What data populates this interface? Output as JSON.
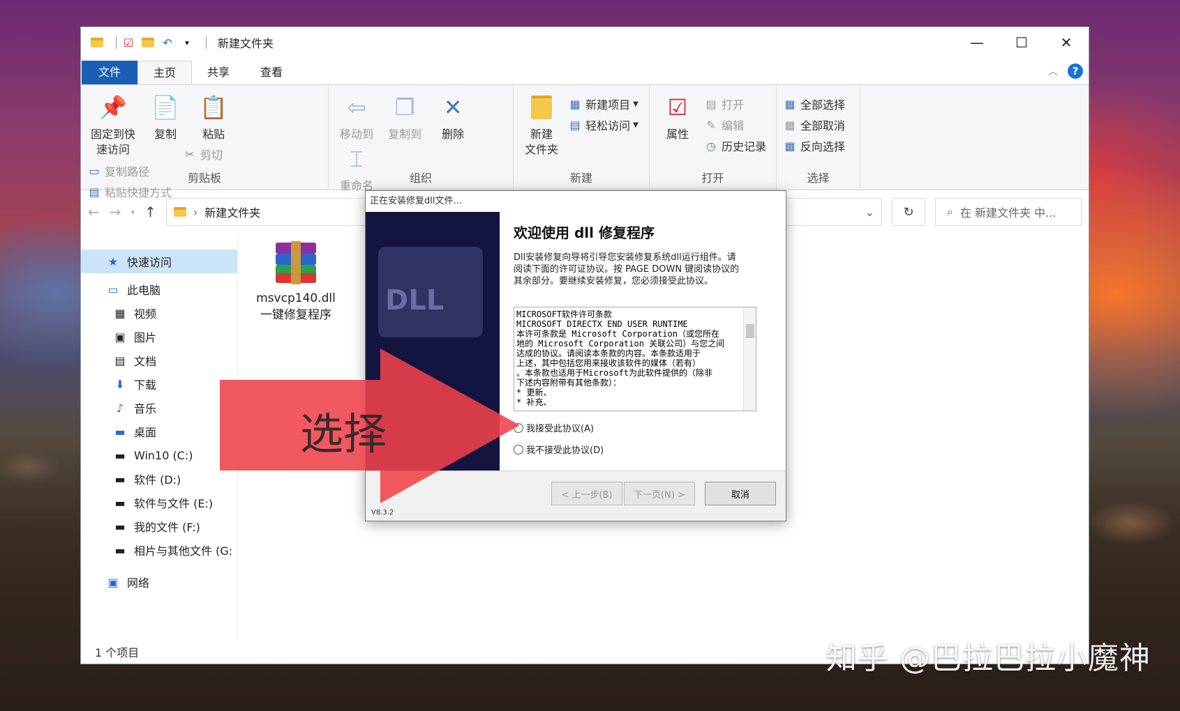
{
  "window": {
    "title": "新建文件夹",
    "controls": {
      "minimize": "—",
      "maximize": "☐",
      "close": "✕"
    }
  },
  "tabs": {
    "file": "文件",
    "home": "主页",
    "share": "共享",
    "view": "查看"
  },
  "ribbon": {
    "clipboard": {
      "label": "剪贴板",
      "pin": "固定到快\n速访问",
      "copy": "复制",
      "paste": "粘贴",
      "copy_path": "复制路径",
      "paste_shortcut": "粘贴快捷方式",
      "cut": "剪切"
    },
    "organize": {
      "label": "组织",
      "move_to": "移动到",
      "copy_to": "复制到",
      "delete": "删除",
      "rename": "重命名"
    },
    "new": {
      "label": "新建",
      "new_folder": "新建\n文件夹",
      "new_item": "新建项目",
      "easy_access": "轻松访问"
    },
    "open": {
      "label": "打开",
      "properties": "属性",
      "open": "打开",
      "edit": "编辑",
      "history": "历史记录"
    },
    "select": {
      "label": "选择",
      "select_all": "全部选择",
      "select_none": "全部取消",
      "invert": "反向选择"
    }
  },
  "address": {
    "path": "新建文件夹",
    "search_placeholder": "在 新建文件夹 中..."
  },
  "nav": {
    "quick_access": "快速访问",
    "this_pc": "此电脑",
    "videos": "视频",
    "pictures": "图片",
    "documents": "文档",
    "downloads": "下载",
    "music": "音乐",
    "desktop": "桌面",
    "drive_c": "Win10 (C:)",
    "drive_d": "软件 (D:)",
    "drive_e": "软件与文件 (E:)",
    "drive_f": "我的文件 (F:)",
    "drive_g": "相片与其他文件 (G:",
    "network": "网络"
  },
  "files": [
    {
      "name_line1": "msvcp140.dll",
      "name_line2": "一键修复程序"
    }
  ],
  "status": {
    "count": "1 个项目"
  },
  "dialog": {
    "title": "正在安装修复dll文件...",
    "side_text": "DLL",
    "heading": "欢迎使用 dll 修复程序",
    "description": "Dll安装修复向导将引导您安装修复系统dll运行组件。请阅读下面的许可证协议。按 PAGE DOWN 键阅读协议的其余部分。要继续安装修复，您必须接受此协议。",
    "license_lines": [
      "MICROSOFT软件许可条款",
      "MICROSOFT DIRECTX END USER RUNTIME",
      "本许可条款是 Microsoft Corporation（或您所在",
      "地的 Microsoft Corporation 关联公司）与您之间",
      "达成的协议。请阅读本条款的内容。本条款适用于",
      "上述，其中包括您用来接收该软件的媒体（若有）",
      "。本条款也适用于Microsoft为此软件提供的（除非",
      "下述内容附带有其他条款）：",
      "* 更新、",
      "* 补充、"
    ],
    "accept": "我接受此协议(A)",
    "decline": "我不接受此协议(D)",
    "back": "< 上一步(B)",
    "next": "下一页(N) >",
    "cancel": "取消",
    "version": "V8.3.2"
  },
  "annotation": {
    "label": "选择"
  },
  "watermark": "知乎 @巴拉巴拉小魔神",
  "colors": {
    "accent": "#1a5fb4",
    "arrow": "#f0414a",
    "dialog_side": "#141440"
  }
}
